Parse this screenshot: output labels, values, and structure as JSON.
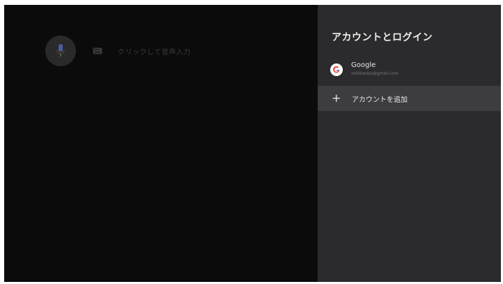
{
  "search": {
    "hint": "クリックして音声入力",
    "mic_icon": "mic-icon",
    "keyboard_icon": "keyboard-icon"
  },
  "panel": {
    "title": "アカウントとログイン",
    "account": {
      "name": "Google",
      "email": "oshikanba@gmail.com",
      "icon": "google-icon"
    },
    "add_account": {
      "label": "アカウントを追加",
      "icon": "plus-icon"
    }
  },
  "colors": {
    "background": "#0b0b0b",
    "panel": "#2b2b2d",
    "highlight": "#3d3d40",
    "mic_button": "#2a2a2a"
  }
}
